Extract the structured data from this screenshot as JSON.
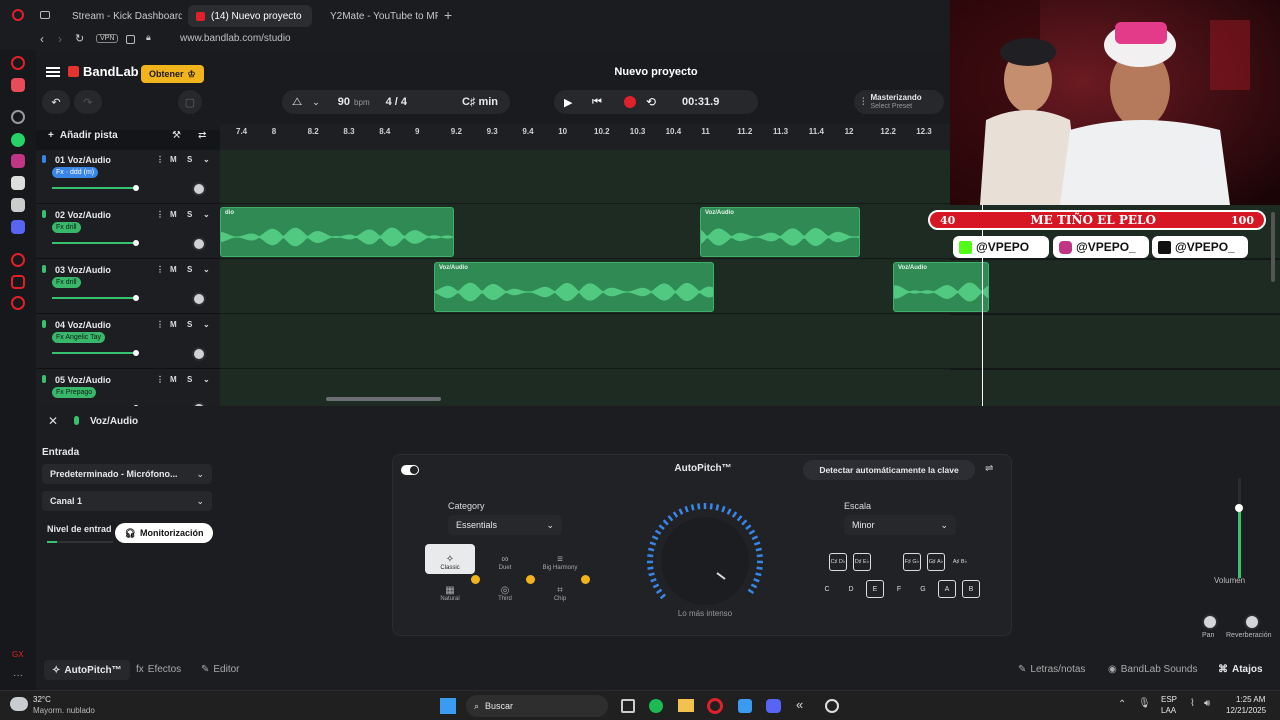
{
  "browser": {
    "tabs": [
      {
        "label": "Stream - Kick Dashboard",
        "active": false
      },
      {
        "label": "(14) Nuevo proyecto",
        "active": true
      },
      {
        "label": "Y2Mate - YouTube to MP...",
        "active": false
      }
    ],
    "url": "www.bandlab.com/studio",
    "vpn_label": "VPN"
  },
  "app": {
    "brand": "BandLab",
    "obtener": "Obtener",
    "project_title": "Nuevo proyecto",
    "bpm_value": "90",
    "bpm_unit": "bpm",
    "time_sig": "4 / 4",
    "key": "C♯ min",
    "time": "00:31.9",
    "mastering_title": "Masterizando",
    "mastering_sub": "Select Preset",
    "add_track": "Añadir pista"
  },
  "ruler": [
    "7.4",
    "8",
    "8.2",
    "8.3",
    "8.4",
    "9",
    "9.2",
    "9.3",
    "9.4",
    "10",
    "10.2",
    "10.3",
    "10.4",
    "11",
    "11.2",
    "11.3",
    "11.4",
    "12",
    "12.2",
    "12.3"
  ],
  "tracks": [
    {
      "name": "01  Voz/Audio",
      "fx": "Fx · ddd (m)",
      "fx_color": "blue",
      "vol": 0.98
    },
    {
      "name": "02  Voz/Audio",
      "fx": "Fx drill",
      "fx_color": "green",
      "vol": 0.98
    },
    {
      "name": "03  Voz/Audio",
      "fx": "Fx drill",
      "fx_color": "green",
      "vol": 0.98
    },
    {
      "name": "04  Voz/Audio",
      "fx": "Fx Angelic Tay",
      "fx_color": "green",
      "vol": 0.98
    },
    {
      "name": "05  Voz/Audio",
      "fx": "Fx Prepago",
      "fx_color": "green",
      "vol": 0.98
    }
  ],
  "clips": [
    {
      "lane": 1,
      "label": "dio"
    },
    {
      "lane": 1,
      "label": "Voz/Audio"
    },
    {
      "lane": 2,
      "label": "Voz/Audio"
    },
    {
      "lane": 2,
      "label": "Voz/Audio"
    }
  ],
  "stream_overlay": {
    "bar_left": "40",
    "bar_title": "ME TIÑO EL PELO",
    "bar_right": "100",
    "socials": [
      "@VPEPO",
      "@VPEPO_",
      "@VPEPO_"
    ]
  },
  "panel": {
    "track_name": "Voz/Audio",
    "entrada_label": "Entrada",
    "input_device": "Predeterminado - Micrófono...",
    "channel": "Canal 1",
    "level_label": "Nivel de entrad",
    "monitor_button": "Monitorización",
    "autopitch_title": "AutoPitch™",
    "detect_key": "Detectar automáticamente la clave",
    "category_label": "Category",
    "category_value": "Essentials",
    "presets": [
      "Classic",
      "Duet",
      "Big Harmony",
      "Natural",
      "Third",
      "Chip"
    ],
    "dial_caption": "Lo más intenso",
    "scale_label": "Escala",
    "scale_value": "Minor",
    "keys_top": [
      "C♯ D♭",
      "D♯ E♭",
      "F♯ G♭",
      "G♯ A♭",
      "A♯ B♭"
    ],
    "keys_bottom": [
      "C",
      "D",
      "E",
      "F",
      "G",
      "A",
      "B"
    ],
    "volume_label": "Volumen",
    "pan_label": "Pan",
    "reverb_label": "Reverberación"
  },
  "footer": {
    "autopitch": "AutoPitch™",
    "efectos": "Efectos",
    "editor": "Editor",
    "letras": "Letras/notas",
    "sounds": "BandLab Sounds",
    "atajos": "Atajos"
  },
  "taskbar": {
    "weather_temp": "32°C",
    "weather_desc": "Mayorm. nublado",
    "search": "Buscar",
    "lang": "ESP",
    "lang_sub": "LAA",
    "time": "1:25 AM",
    "date": "12/21/2025"
  },
  "colors": {
    "accent": "#37c26f",
    "record": "#e0202a",
    "brand_red": "#e5342c",
    "obtener": "#f2b41c"
  }
}
